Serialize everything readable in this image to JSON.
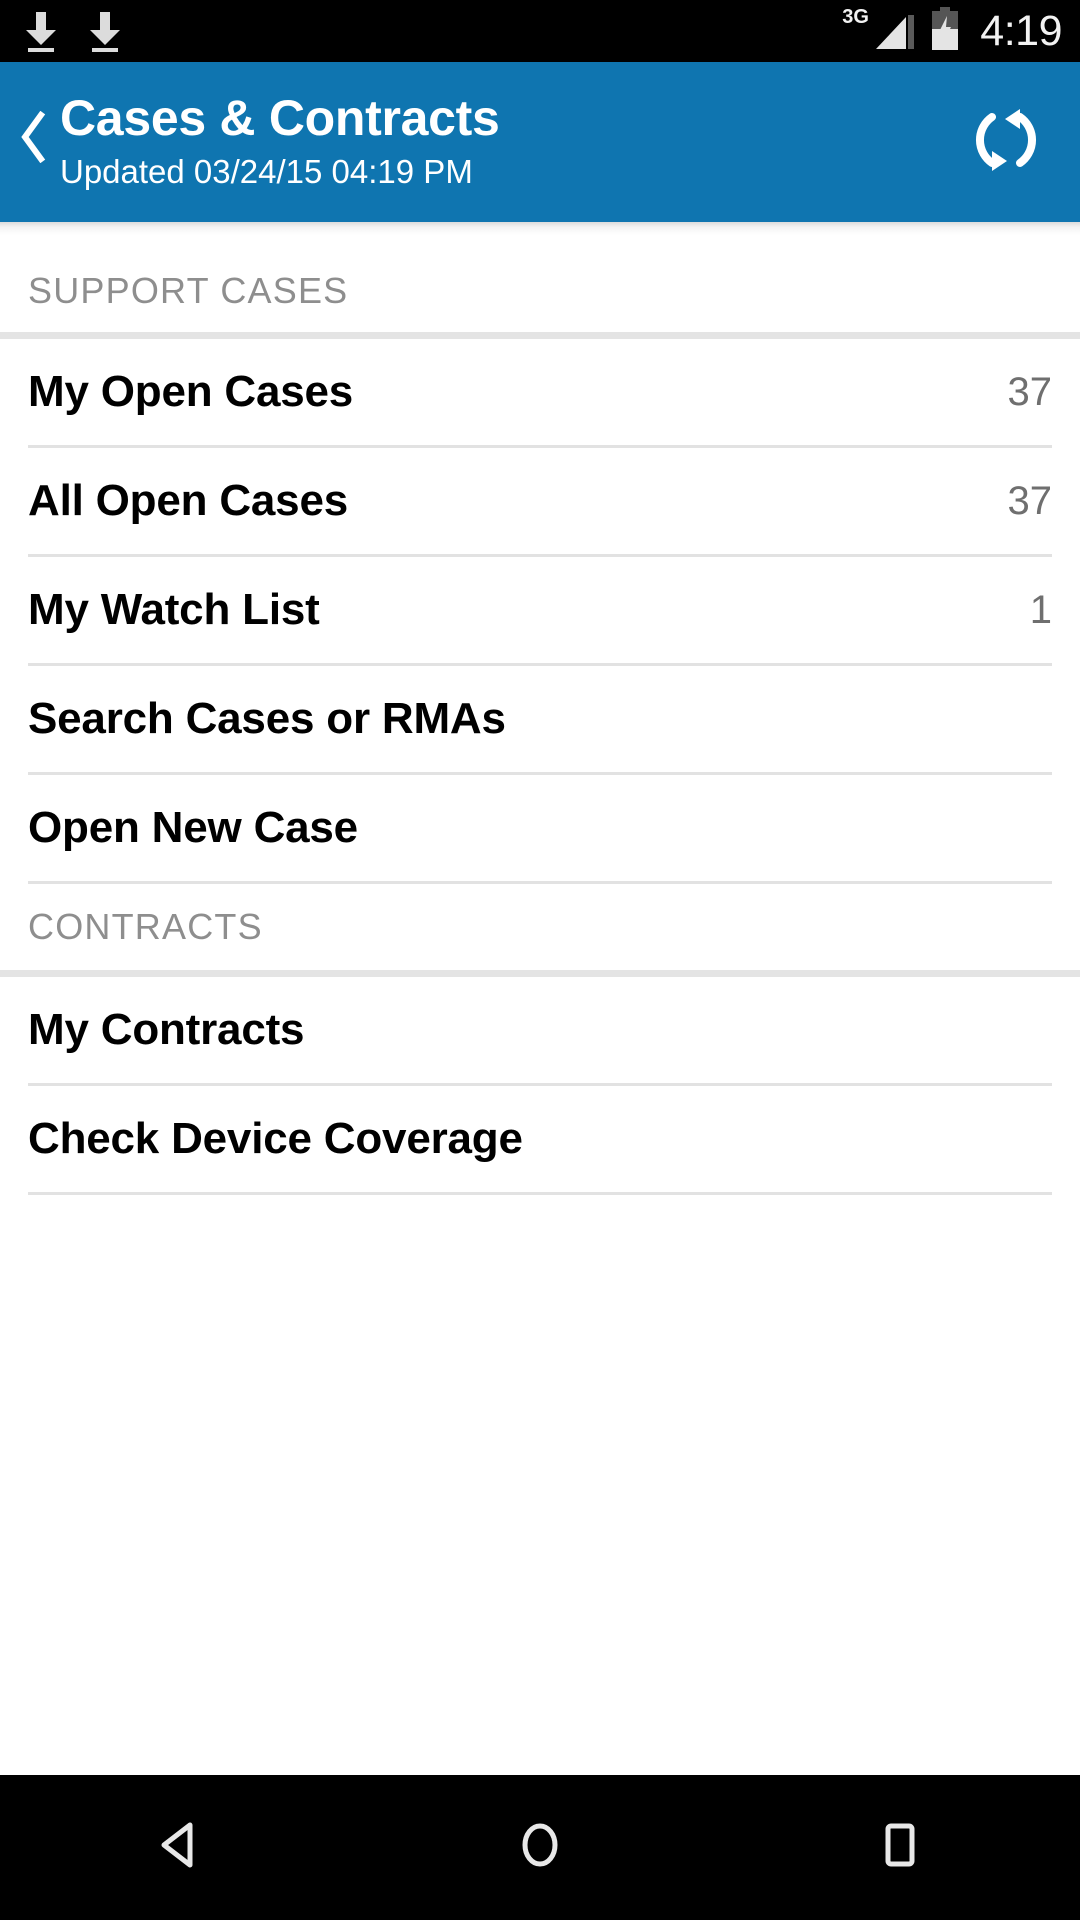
{
  "status_bar": {
    "left_icons": [
      "download-icon",
      "download-icon"
    ],
    "network_label": "3G",
    "signal_icon": "signal-bars-icon",
    "battery_icon": "battery-charging-icon",
    "clock": "4:19"
  },
  "app_bar": {
    "back_icon": "back-chevron-icon",
    "title": "Cases & Contracts",
    "subtitle": "Updated 03/24/15 04:19 PM",
    "refresh_icon": "refresh-sync-icon",
    "background_color": "#0f75b0",
    "text_color": "#ffffff"
  },
  "sections": [
    {
      "header": "SUPPORT CASES",
      "rows": [
        {
          "label": "My Open Cases",
          "value": "37"
        },
        {
          "label": "All Open Cases",
          "value": "37"
        },
        {
          "label": "My Watch List",
          "value": "1"
        },
        {
          "label": "Search Cases or RMAs",
          "value": ""
        },
        {
          "label": "Open New Case",
          "value": ""
        }
      ]
    },
    {
      "header": "CONTRACTS",
      "rows": [
        {
          "label": "My Contracts",
          "value": ""
        },
        {
          "label": "Check Device Coverage",
          "value": ""
        }
      ]
    }
  ],
  "nav_bar": {
    "back": "nav-back-icon",
    "home": "nav-home-icon",
    "recents": "nav-recents-icon"
  },
  "colors": {
    "accent": "#0f75b0",
    "section_label": "#8e8e8e",
    "row_value": "#6f6f6f",
    "divider": "#e2e2e2",
    "section_divider": "#e4e4e4"
  }
}
